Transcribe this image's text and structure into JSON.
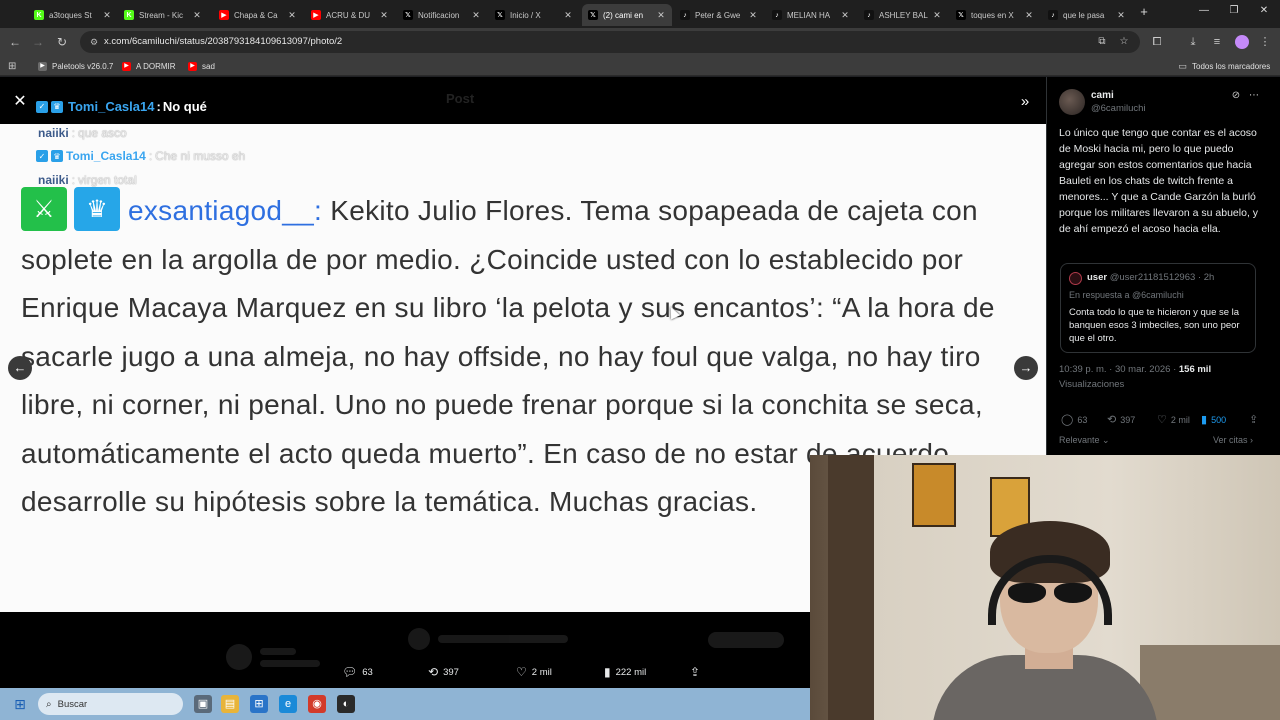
{
  "browser": {
    "tabs": [
      {
        "title": "a3toques St",
        "fav": "K",
        "color": "#53fc18"
      },
      {
        "title": "Stream - Kic",
        "fav": "K",
        "color": "#53fc18"
      },
      {
        "title": "Chapa & Ca",
        "fav": "▶",
        "color": "#ff0000"
      },
      {
        "title": "ACRU & DU",
        "fav": "▶",
        "color": "#ff0000"
      },
      {
        "title": "Notificacion",
        "fav": "𝕏",
        "color": "#000000"
      },
      {
        "title": "Inicio / X",
        "fav": "𝕏",
        "color": "#000000"
      },
      {
        "title": "(2) cami en",
        "fav": "𝕏",
        "color": "#000000"
      },
      {
        "title": "Peter & Gwe",
        "fav": "♪",
        "color": "#111111"
      },
      {
        "title": "MELIAN HA",
        "fav": "♪",
        "color": "#111111"
      },
      {
        "title": "ASHLEY BAL",
        "fav": "♪",
        "color": "#111111"
      },
      {
        "title": "toques en X",
        "fav": "𝕏",
        "color": "#000000"
      },
      {
        "title": "que le pasa",
        "fav": "♪",
        "color": "#111111"
      }
    ],
    "url": "x.com/6camiluchi/status/2038793184109613097/photo/2",
    "bookmarks": [
      {
        "label": "Paletools v26.0.7",
        "color": "#6a6a6a"
      },
      {
        "label": "A DORMIR",
        "color": "#ff0000"
      },
      {
        "label": "sad",
        "color": "#ff0000"
      }
    ],
    "all_bookmarks": "Todos los marcadores"
  },
  "viewer": {
    "faded_header": "Post",
    "top_chat": {
      "user": "Tomi_Casla14",
      "message": "No qué"
    },
    "chat_lines": [
      {
        "user": "naiiki",
        "message": "que asco"
      },
      {
        "user": "Tomi_Casla14",
        "message": "Che ni musso eh"
      },
      {
        "user": "naiiki",
        "message": "virgen total"
      }
    ],
    "quote": {
      "user": "exsantiagod__:",
      "text": " Kekito Julio Flores. Tema sopapeada de cajeta con soplete en la argolla de por medio. ¿Coincide usted con lo establecido por Enrique Macaya Marquez en su libro ‘la pelota y sus encantos’: “A la hora de sacarle jugo a una almeja, no hay offside, no hay foul que valga, no hay tiro libre, ni corner, ni penal. Uno no puede frenar porque si la conchita se seca, automáticamente el acto queda muerto”. En caso de no estar de acuerdo, desarrolle su hipótesis sobre la temática. Muchas gracias."
    },
    "actions": {
      "replies": "63",
      "reposts": "397",
      "likes": "2 mil",
      "views": "222 mil"
    }
  },
  "sidebar": {
    "name": "cami",
    "handle": "@6camiluchi",
    "body": "Lo único que tengo que contar es el acoso de Moski hacia mi, pero lo que puedo agregar son estos comentarios que hacia Bauleti en los chats de twitch frente a menores...  Y que a Cande Garzón la burló porque los militares llevaron a su abuelo, y de ahí empezó el acoso hacia ella.",
    "reply": {
      "name": "user",
      "handle": "@user21181512963 · 2h",
      "in_reply": "En respuesta a @6camiluchi",
      "text": "Conta todo lo que te hicieron y que se la banquen esos 3 imbeciles, son uno peor que el otro."
    },
    "timestamp": "10:39 p. m. · 30 mar. 2026 · ",
    "views_count": "156 mil",
    "views_label": "Visualizaciones",
    "stats": {
      "replies": "63",
      "reposts": "397",
      "likes": "2 mil",
      "bookmarks": "500"
    },
    "sort_label": "Relevante",
    "quotes_label": "Ver citas"
  },
  "taskbar": {
    "search_placeholder": "Buscar"
  }
}
